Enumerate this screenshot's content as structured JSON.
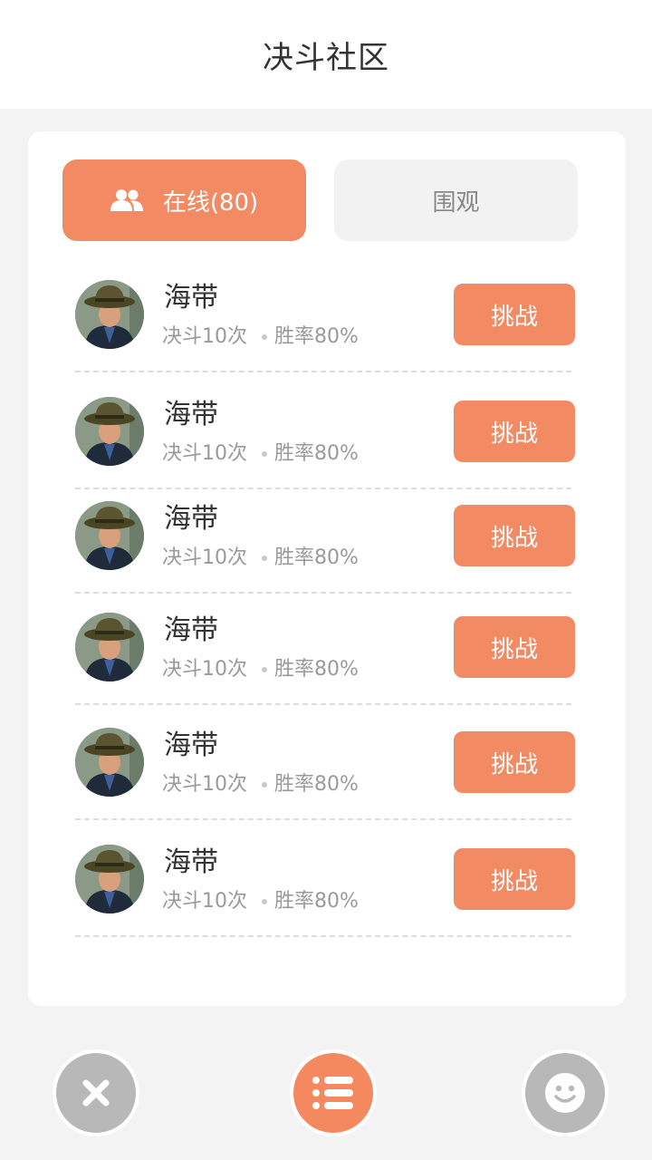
{
  "header": {
    "title": "决斗社区"
  },
  "tabs": {
    "online": {
      "label": "在线(80)",
      "icon": "users-icon"
    },
    "watch": {
      "label": "围观"
    }
  },
  "players": [
    {
      "name": "海带",
      "duels": "决斗10次",
      "win_rate": "胜率80%",
      "action": "挑战"
    },
    {
      "name": "海带",
      "duels": "决斗10次",
      "win_rate": "胜率80%",
      "action": "挑战"
    },
    {
      "name": "海带",
      "duels": "决斗10次",
      "win_rate": "胜率80%",
      "action": "挑战"
    },
    {
      "name": "海带",
      "duels": "决斗10次",
      "win_rate": "胜率80%",
      "action": "挑战"
    },
    {
      "name": "海带",
      "duels": "决斗10次",
      "win_rate": "胜率80%",
      "action": "挑战"
    },
    {
      "name": "海带",
      "duels": "决斗10次",
      "win_rate": "胜率80%",
      "action": "挑战"
    }
  ],
  "bottom_bar": {
    "close_icon": "close-icon",
    "list_icon": "list-icon",
    "emoji_icon": "smiley-icon"
  },
  "colors": {
    "accent": "#f28b63",
    "background": "#f3f3f3",
    "gray_button": "#b8b8b8"
  }
}
